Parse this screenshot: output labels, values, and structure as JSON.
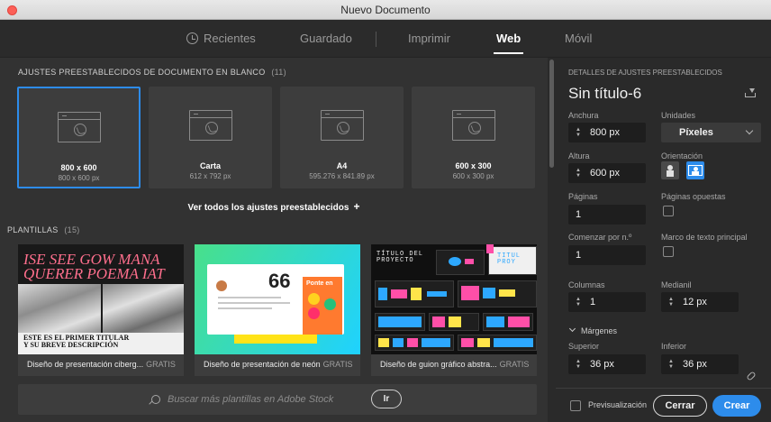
{
  "window": {
    "title": "Nuevo Documento"
  },
  "tabs": [
    {
      "label": "Recientes",
      "icon": "clock-icon"
    },
    {
      "label": "Guardado"
    },
    {
      "label": "Imprimir"
    },
    {
      "label": "Web",
      "active": true
    },
    {
      "label": "Móvil"
    }
  ],
  "presets": {
    "title": "AJUSTES PREESTABLECIDOS DE DOCUMENTO EN BLANCO",
    "count": "(11)",
    "items": [
      {
        "name": "800 x 600",
        "size": "800 x 600 px",
        "selected": true,
        "icon": "web-document-icon"
      },
      {
        "name": "Carta",
        "size": "612 x 792 px",
        "icon": "web-document-icon"
      },
      {
        "name": "A4",
        "size": "595.276 x 841.89 px",
        "icon": "web-document-icon"
      },
      {
        "name": "600 x 300",
        "size": "600 x 300 px",
        "icon": "web-document-icon"
      }
    ],
    "view_all": "Ver todos los ajustes preestablecidos",
    "view_all_symbol": "+"
  },
  "templates": {
    "title": "PLANTILLAS",
    "count": "(15)",
    "items": [
      {
        "name": "Diseño de presentación ciberg...",
        "price": "GRATIS",
        "thumb_text": [
          "ISE SEE GOW MANA",
          "QUERER POEMA IAT",
          "ESTE ES EL PRIMER TITULAR",
          "Y SU BREVE DESCRIPCIÓN"
        ]
      },
      {
        "name": "Diseño de presentación de neón",
        "price": "GRATIS",
        "thumb_text": [
          "66",
          "Ponte en"
        ]
      },
      {
        "name": "Diseño de guion gráfico abstra...",
        "price": "GRATIS",
        "thumb_text": [
          "TÍTULO DEL",
          "PROYECTO",
          "TITUL",
          "PROY"
        ]
      }
    ]
  },
  "search": {
    "placeholder": "Buscar más plantillas en Adobe Stock",
    "button": "Ir"
  },
  "details": {
    "title": "DETALLES DE AJUSTES PREESTABLECIDOS",
    "doc_name": "Sin título-6",
    "width_label": "Anchura",
    "width_value": "800 px",
    "units_label": "Unidades",
    "units_value": "Píxeles",
    "height_label": "Altura",
    "height_value": "600 px",
    "orientation_label": "Orientación",
    "pages_label": "Páginas",
    "pages_value": "1",
    "facing_label": "Páginas opuestas",
    "start_label": "Comenzar por n.º",
    "start_value": "1",
    "frame_label": "Marco de texto principal",
    "columns_label": "Columnas",
    "columns_value": "1",
    "gutter_label": "Medianil",
    "gutter_value": "12 px",
    "margins_label": "Márgenes",
    "top_label": "Superior",
    "top_value": "36 px",
    "bottom_label": "Inferior",
    "bottom_value": "36 px"
  },
  "footer": {
    "preview_label": "Previsualización",
    "close_label": "Cerrar",
    "create_label": "Crear"
  },
  "colors": {
    "accent": "#2d8ceb",
    "background": "#323232",
    "panel": "#2a2a2a"
  }
}
